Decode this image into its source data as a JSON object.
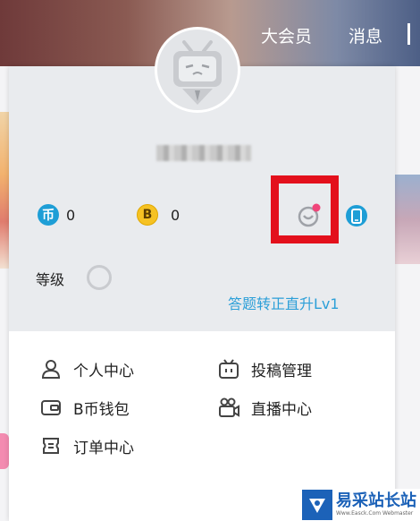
{
  "header": {
    "nav": [
      {
        "label": "大会员"
      },
      {
        "label": "消息"
      }
    ]
  },
  "profile": {
    "stats": [
      {
        "icon": "b-coin-icon",
        "glyph": "币",
        "value": "0"
      },
      {
        "icon": "hard-coin-icon",
        "glyph": "B",
        "value": "0"
      }
    ],
    "level_label": "等级",
    "upgrade_link": "答题转正直升Lv1"
  },
  "menu": {
    "items": [
      {
        "icon": "person-icon",
        "label": "个人中心"
      },
      {
        "icon": "upload-icon",
        "label": "投稿管理"
      },
      {
        "icon": "wallet-icon",
        "label": "B币钱包"
      },
      {
        "icon": "live-camera-icon",
        "label": "直播中心"
      },
      {
        "icon": "order-icon",
        "label": "订单中心"
      }
    ]
  },
  "watermark": {
    "title": "易采站长站",
    "subtitle": "Www.Easck.Com Webmaster"
  },
  "colors": {
    "accent_blue": "#2c9fd8",
    "highlight_red": "#e3101c",
    "notification_pink": "#f0457a",
    "coin_gold": "#f6c223"
  }
}
